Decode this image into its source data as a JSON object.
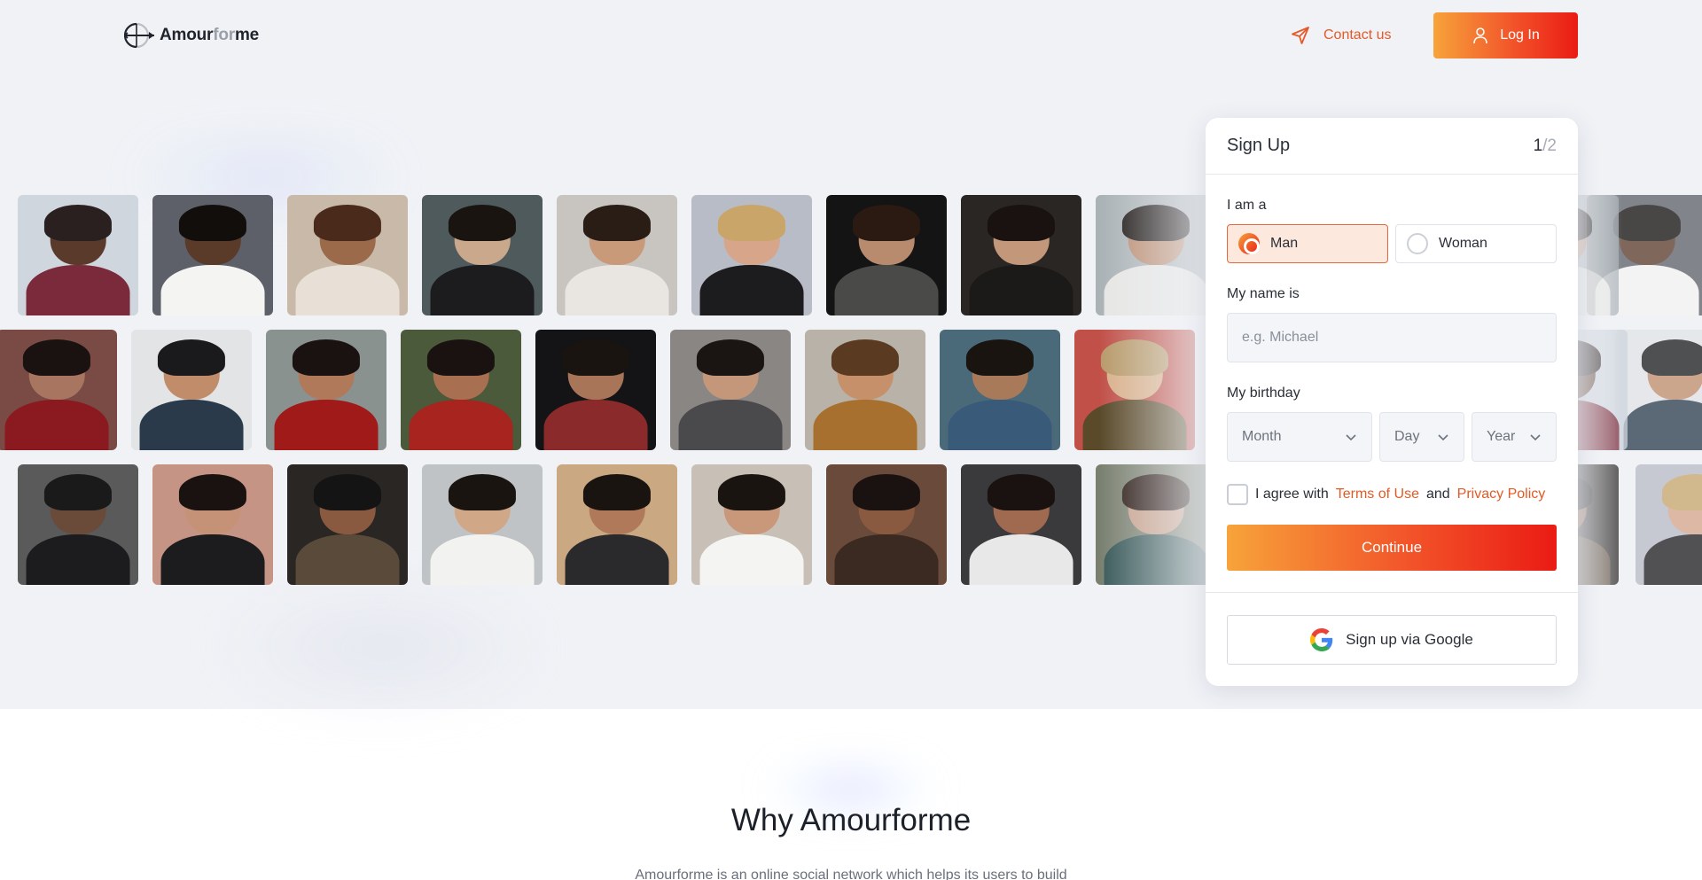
{
  "header": {
    "logo": {
      "part1": "Amour",
      "part2": "for",
      "part3": "me"
    },
    "contact_label": "Contact us",
    "login_label": "Log In"
  },
  "colors": {
    "accent_start": "#f7a33a",
    "accent_end": "#ea1b14",
    "link": "#e25a25",
    "hero_bg": "#f0f2f6"
  },
  "photos": [
    {
      "person": "man in striped sweater, city buildings"
    },
    {
      "person": "woman with curly afro, white top"
    },
    {
      "person": "woman with curly brown hair"
    },
    {
      "person": "bearded man in black hoodie"
    },
    {
      "person": "woman sitting on street"
    },
    {
      "person": "blonde woman in black top"
    },
    {
      "person": "man in grey sweater"
    },
    {
      "person": "smiling woman in black"
    },
    {
      "person": "smiling man"
    },
    {
      "person": "woman with dark hair, red top"
    },
    {
      "person": "man in navy tank top"
    },
    {
      "person": "woman in red dress"
    },
    {
      "person": "woman sitting in trees"
    },
    {
      "person": "man in red striped shirt"
    },
    {
      "person": "woman with hand in hair"
    },
    {
      "person": "woman with wavy hair by sea"
    },
    {
      "person": "man by rocky coast"
    },
    {
      "person": "blonde woman by sign"
    },
    {
      "person": "bearded man in beanie"
    },
    {
      "person": "woman with space buns"
    },
    {
      "person": "man in leopard shirt"
    },
    {
      "person": "woman in white dress"
    },
    {
      "person": "man in black jacket"
    },
    {
      "person": "woman in white shirt"
    },
    {
      "person": "man on balcony"
    },
    {
      "person": "woman in white tee"
    },
    {
      "person": "woman by colorful wheel"
    }
  ],
  "signup": {
    "title": "Sign Up",
    "step_current": "1",
    "step_total": "/2",
    "gender_label": "I am a",
    "gender_options": [
      {
        "label": "Man",
        "selected": true
      },
      {
        "label": "Woman",
        "selected": false
      }
    ],
    "name_label": "My name is",
    "name_placeholder": "e.g. Michael",
    "birthday_label": "My birthday",
    "month_placeholder": "Month",
    "day_placeholder": "Day",
    "year_placeholder": "Year",
    "agree_prefix": "I agree with",
    "terms_label": "Terms of Use",
    "agree_and": "and",
    "privacy_label": "Privacy Policy",
    "agreed": false,
    "continue_label": "Continue",
    "google_label": "Sign up via Google"
  },
  "why": {
    "title": "Why Amourforme",
    "text": "Amourforme is an online social network which helps its users to build"
  }
}
